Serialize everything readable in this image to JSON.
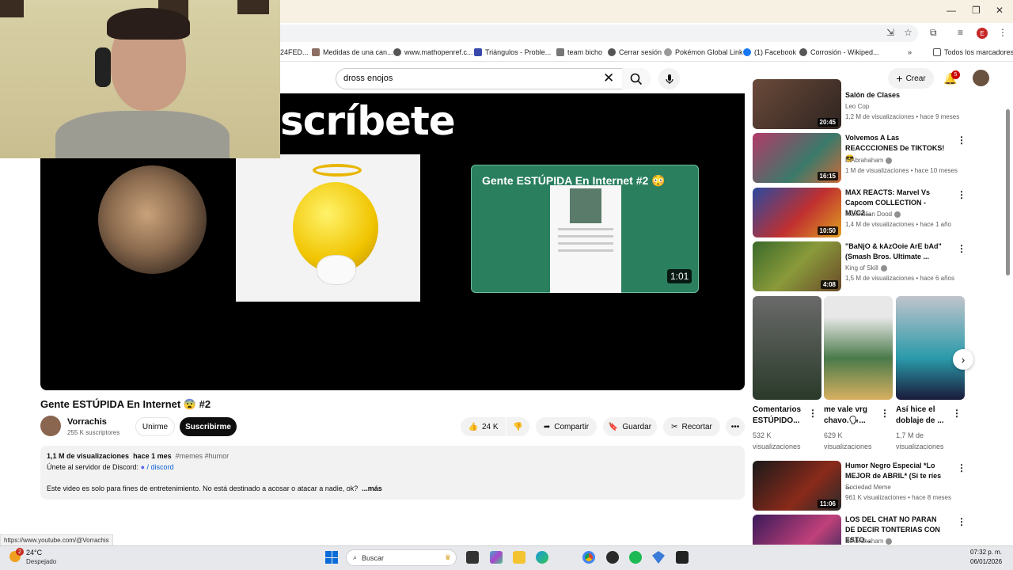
{
  "browser": {
    "bookmarks": [
      {
        "label": "24FED..."
      },
      {
        "label": "Medidas de una can..."
      },
      {
        "label": "www.mathopenref.c..."
      },
      {
        "label": "Triángulos - Proble..."
      },
      {
        "label": "team bicho"
      },
      {
        "label": "Cerrar sesión"
      },
      {
        "label": "Pokémon Global Link"
      },
      {
        "label": "(1) Facebook"
      },
      {
        "label": "Corrosión - Wikiped..."
      }
    ],
    "bookmarks_overflow": "»",
    "all_bookmarks": "Todos los marcadores",
    "profile_initial": "E",
    "status_url": "https://www.youtube.com/@Vorrachis"
  },
  "header": {
    "search_query": "dross enojos",
    "create_label": "Crear",
    "notifications_count": "5"
  },
  "player": {
    "overlay_text": "scríbete",
    "endcard_title": "Gente ESTÚPIDA En Internet #2 😳",
    "endcard_duration": "1:01"
  },
  "video": {
    "title": "Gente ESTÚPIDA En Internet 😨 #2",
    "channel_name": "Vorrachis",
    "channel_subs": "255 K suscriptores",
    "join_label": "Unirme",
    "subscribe_label": "Suscribirme",
    "likes": "24 K",
    "share_label": "Compartir",
    "save_label": "Guardar",
    "clip_label": "Recortar",
    "more_label": "•••"
  },
  "description": {
    "views": "1,1 M de visualizaciones",
    "date": "hace 1 mes",
    "tags": "#memes #humor",
    "line1": "Únete al servidor de Discord:",
    "link": "/ discord",
    "line2": "Este video es solo para fines de entretenimiento. No está destinado a acosar o atacar a nadie, ok?",
    "more": "...más"
  },
  "sidebar": {
    "videos": [
      {
        "title": "Salón de Clases",
        "channel": "Leo Cop",
        "meta": "1,2 M de visualizaciones • hace 9 meses",
        "duration": "20:45",
        "verified": false
      },
      {
        "title": "Volvemos A Las REACCCIONES De TIKTOKS! 😎",
        "channel": "ElAbrahaham",
        "meta": "1 M de visualizaciones • hace 10 meses",
        "duration": "16:15",
        "verified": true
      },
      {
        "title": "MAX REACTS: Marvel Vs Capcom COLLECTION - MVC2...",
        "channel": "Maximilian Dood",
        "meta": "1,4 M de visualizaciones • hace 1 año",
        "duration": "10:50",
        "verified": true
      },
      {
        "title": "\"BaNjO & kAzOoie ArE bAd\" (Smash Bros. Ultimate ...",
        "channel": "King of Skill",
        "meta": "1,5 M de visualizaciones • hace 6 años",
        "duration": "4:08",
        "verified": true
      },
      {
        "title": "Humor Negro Especial *Lo MEJOR de ABRIL* (Si te ríes ...",
        "channel": "Sociedad Meme",
        "meta": "961 K visualizaciones • hace 8 meses",
        "duration": "11:06",
        "verified": false
      },
      {
        "title": "LOS DEL CHAT NO PARAN DE DECIR TONTERIAS CON ESTO...",
        "channel": "ElAbrahaham",
        "meta": "",
        "duration": "",
        "verified": true
      }
    ],
    "shorts": [
      {
        "title": "Comentarios ESTÚPIDO...",
        "views": "532 K visualizaciones"
      },
      {
        "title": "me vale vrg chavo.🗣...",
        "views": "629 K visualizaciones"
      },
      {
        "title": "Así hice el doblaje de ...",
        "views": "1,7 M de visualizaciones"
      }
    ]
  },
  "taskbar": {
    "temp": "24°C",
    "weather": "Despejado",
    "weather_badge": "2",
    "search_label": "Buscar",
    "time": "07:32 p. m.",
    "date": "06/01/2026"
  },
  "colors": {
    "accent_red": "#cc0000",
    "link_blue": "#065fd4",
    "endcard_green": "#2a7f5f"
  }
}
